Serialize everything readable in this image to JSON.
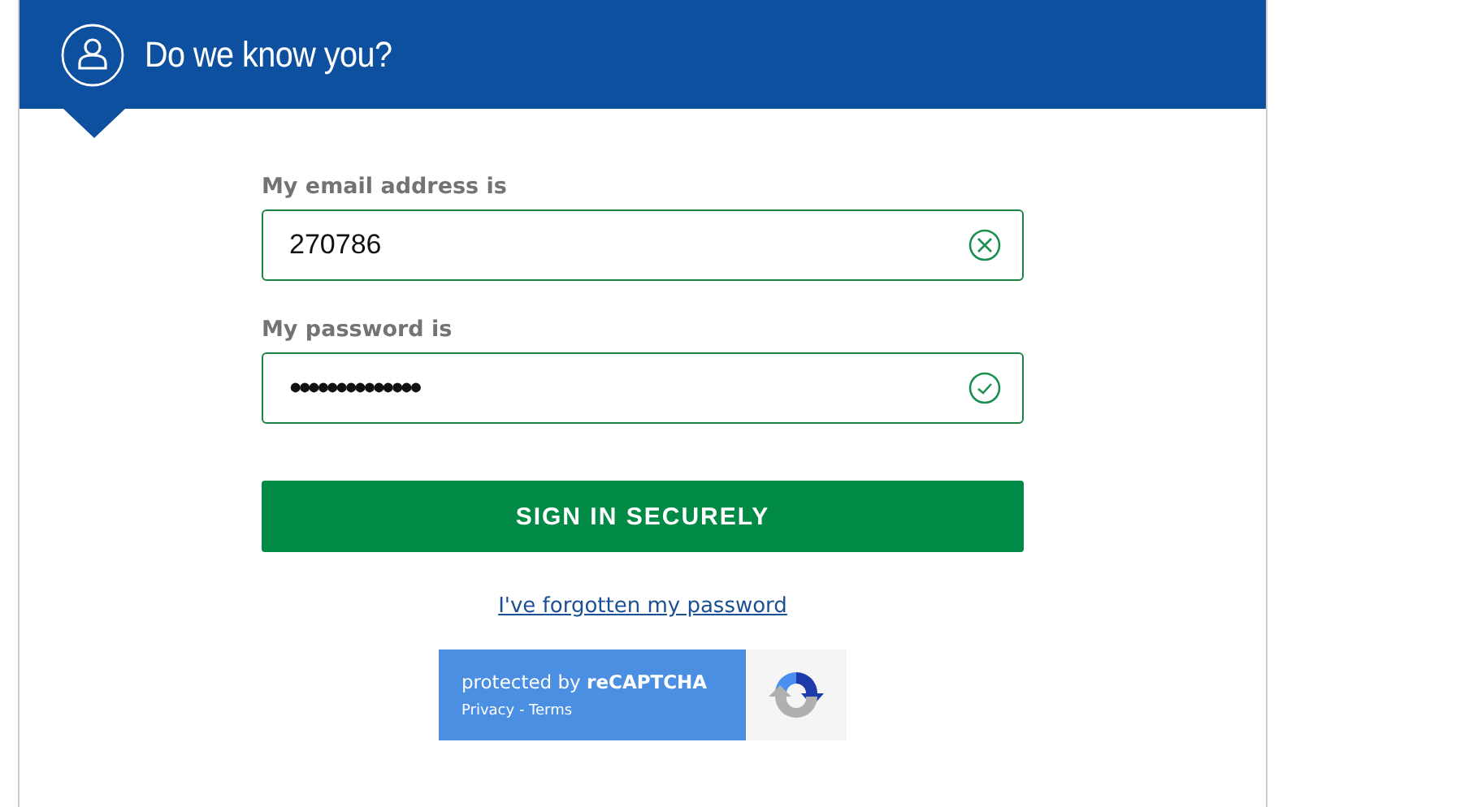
{
  "header": {
    "title": "Do we know you?"
  },
  "fields": [
    {
      "label": "My email address is",
      "value": "270786",
      "kind": "clearable"
    },
    {
      "label": "My password is",
      "value": "••••••••••••••",
      "kind": "verified"
    }
  ],
  "submit": "SIGN IN SECURELY",
  "forgot_link": "I've forgotten my password",
  "recaptcha": {
    "text": "protected by **reCAPTCHA**",
    "links": "Privacy - Terms"
  }
}
